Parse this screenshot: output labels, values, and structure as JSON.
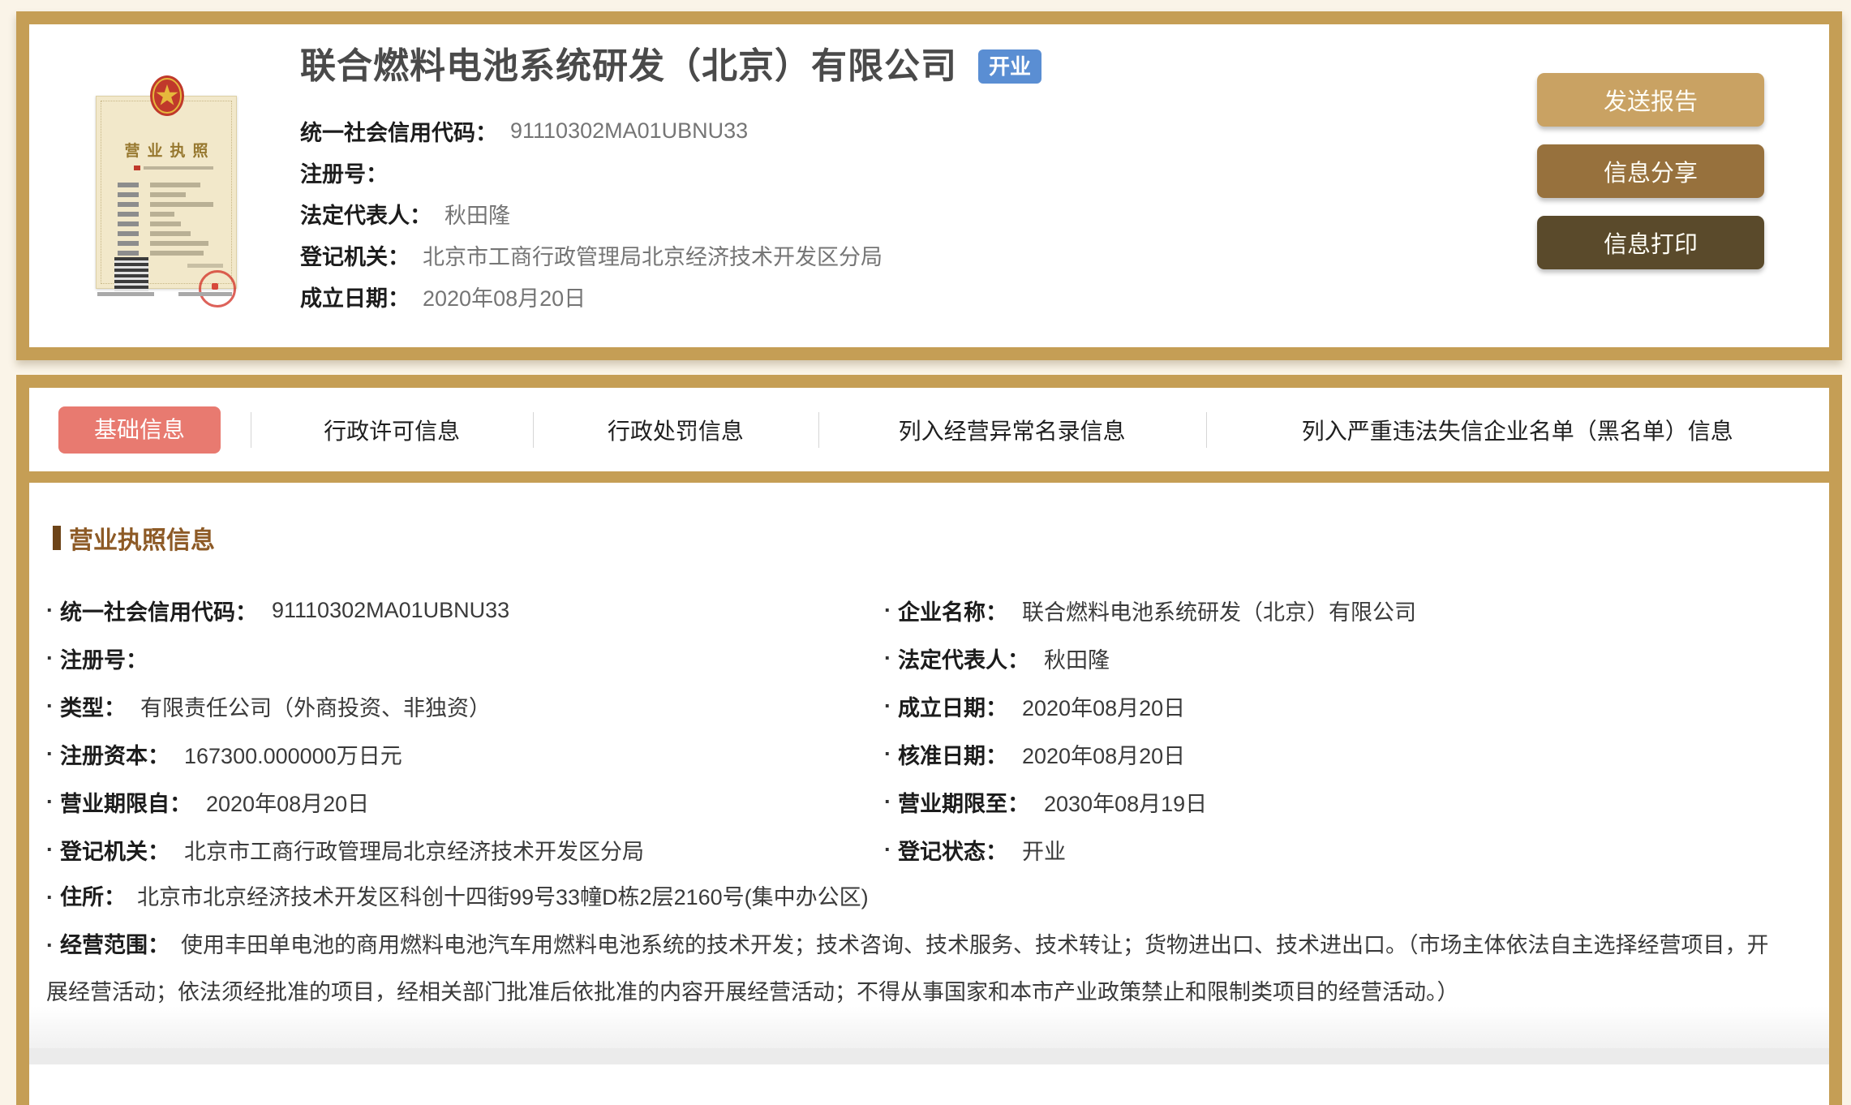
{
  "theme": {
    "page_bg": "#faf4e8",
    "gold": "#c59e55",
    "active_tab": "#e87a70",
    "badge_blue": "#5a8ed3",
    "btn_send": "#c9a263",
    "btn_share": "#97713d",
    "btn_print": "#5a4a2b",
    "section_brown": "#8d5a26"
  },
  "header": {
    "company_name": "联合燃料电池系统研发（北京）有限公司",
    "status_badge": "开业",
    "fields": [
      {
        "label": "统一社会信用代码：",
        "value": "91110302MA01UBNU33"
      },
      {
        "label": "注册号：",
        "value": ""
      },
      {
        "label": "法定代表人：",
        "value": "秋田隆"
      },
      {
        "label": "登记机关：",
        "value": "北京市工商行政管理局北京经济技术开发区分局"
      },
      {
        "label": "成立日期：",
        "value": "2020年08月20日"
      }
    ],
    "buttons": [
      {
        "label": "发送报告",
        "color": "#c9a263"
      },
      {
        "label": "信息分享",
        "color": "#97713d"
      },
      {
        "label": "信息打印",
        "color": "#5a4a2b"
      }
    ]
  },
  "license_thumb": {
    "title": "营业执照"
  },
  "tabs": {
    "items": [
      {
        "label": "基础信息",
        "active": true
      },
      {
        "label": "行政许可信息"
      },
      {
        "label": "行政处罚信息"
      },
      {
        "label": "列入经营异常名录信息"
      },
      {
        "label": "列入严重违法失信企业名单（黑名单）信息"
      }
    ]
  },
  "body": {
    "section_title": "营业执照信息",
    "left_rows": [
      {
        "label": "统一社会信用代码：",
        "value": "91110302MA01UBNU33"
      },
      {
        "label": "注册号：",
        "value": ""
      },
      {
        "label": "类型：",
        "value": "有限责任公司（外商投资、非独资）"
      },
      {
        "label": "注册资本：",
        "value": "167300.000000万日元"
      },
      {
        "label": "营业期限自：",
        "value": "2020年08月20日"
      },
      {
        "label": "登记机关：",
        "value": "北京市工商行政管理局北京经济技术开发区分局"
      }
    ],
    "right_rows": [
      {
        "label": "企业名称：",
        "value": "联合燃料电池系统研发（北京）有限公司"
      },
      {
        "label": "法定代表人：",
        "value": "秋田隆"
      },
      {
        "label": "成立日期：",
        "value": "2020年08月20日"
      },
      {
        "label": "核准日期：",
        "value": "2020年08月20日"
      },
      {
        "label": "营业期限至：",
        "value": "2030年08月19日"
      },
      {
        "label": "登记状态：",
        "value": "开业"
      }
    ],
    "full_rows": [
      {
        "label": "住所：",
        "value": "北京市北京经济技术开发区科创十四街99号33幢D栋2层2160号(集中办公区)"
      },
      {
        "label": "经营范围：",
        "value": "使用丰田单电池的商用燃料电池汽车用燃料电池系统的技术开发；技术咨询、技术服务、技术转让；货物进出口、技术进出口。（市场主体依法自主选择经营项目，开展经营活动；依法须经批准的项目，经相关部门批准后依批准的内容开展经营活动；不得从事国家和本市产业政策禁止和限制类项目的经营活动。）"
      }
    ]
  }
}
